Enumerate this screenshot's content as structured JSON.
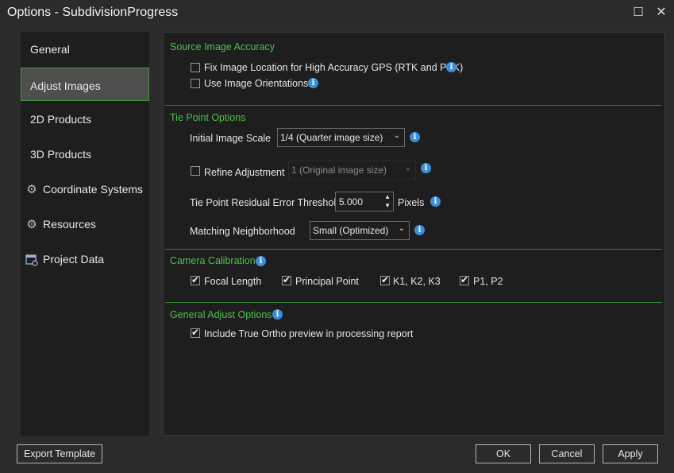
{
  "window": {
    "title": "Options - SubdivisionProgress",
    "maximize_icon": "☐",
    "close_icon": "✕"
  },
  "nav": [
    {
      "label": "General",
      "icon": ""
    },
    {
      "label": "Adjust Images",
      "icon": "",
      "selected": true
    },
    {
      "label": "2D Products",
      "icon": ""
    },
    {
      "label": "3D Products",
      "icon": ""
    },
    {
      "label": "Coordinate Systems",
      "icon": "gear-icon"
    },
    {
      "label": "Resources",
      "icon": "gear-icon"
    },
    {
      "label": "Project Data",
      "icon": "project-data-icon"
    }
  ],
  "source_accuracy": {
    "title": "Source Image Accuracy",
    "fix_location": {
      "label": "Fix Image Location for High Accuracy GPS (RTK and PPK)",
      "checked": false
    },
    "use_orientations": {
      "label": "Use Image Orientations",
      "checked": false
    }
  },
  "tie_point": {
    "title": "Tie Point Options",
    "initial_scale_label": "Initial Image Scale",
    "initial_scale_value": "1/4 (Quarter image size)",
    "refine_label": "Refine Adjustment",
    "refine_checked": false,
    "refine_value": "1 (Original image size)",
    "residual_label": "Tie Point Residual Error Threshold",
    "residual_value": "5.000",
    "residual_unit": "Pixels",
    "neighborhood_label": "Matching Neighborhood",
    "neighborhood_value": "Small (Optimized)"
  },
  "camera_calibration": {
    "title": "Camera Calibration",
    "focal_length": {
      "label": "Focal Length",
      "checked": true
    },
    "principal_point": {
      "label": "Principal Point",
      "checked": true
    },
    "k123": {
      "label": "K1, K2, K3",
      "checked": true
    },
    "p12": {
      "label": "P1, P2",
      "checked": true
    }
  },
  "general_adjust": {
    "title": "General Adjust Options",
    "true_ortho": {
      "label": "Include True Ortho preview in processing report",
      "checked": true
    }
  },
  "buttons": {
    "export": "Export Template",
    "ok": "OK",
    "cancel": "Cancel",
    "apply": "Apply"
  },
  "colors": {
    "accent_green": "#4ec04e",
    "info_blue": "#3c8fd9",
    "background": "#2b2b2b",
    "panel": "#1e1e1e"
  }
}
